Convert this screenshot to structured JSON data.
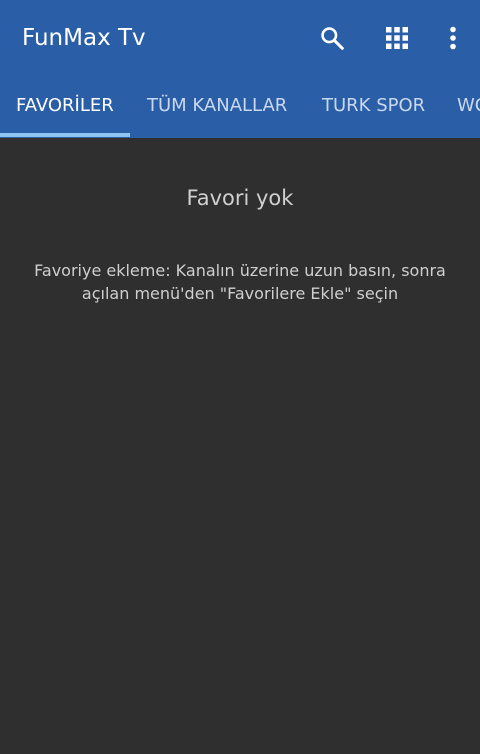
{
  "app": {
    "title": "FunMax Tv",
    "colors": {
      "appbar": "#2a5fa8",
      "tab_indicator": "#8fc3f0",
      "background": "#2f2f2f"
    }
  },
  "toolbar": {
    "icons": [
      "search-icon",
      "apps-grid-icon",
      "more-vert-icon"
    ]
  },
  "tabs": [
    {
      "label": "FAVORİLER",
      "selected": true
    },
    {
      "label": "TÜM KANALLAR",
      "selected": false
    },
    {
      "label": "TURK SPOR",
      "selected": false
    },
    {
      "label": "WO",
      "selected": false
    }
  ],
  "empty_state": {
    "title": "Favori yok",
    "hint": "Favoriye ekleme: Kanalın üzerine uzun basın, sonra açılan menü'den \"Favorilere Ekle\" seçin"
  }
}
